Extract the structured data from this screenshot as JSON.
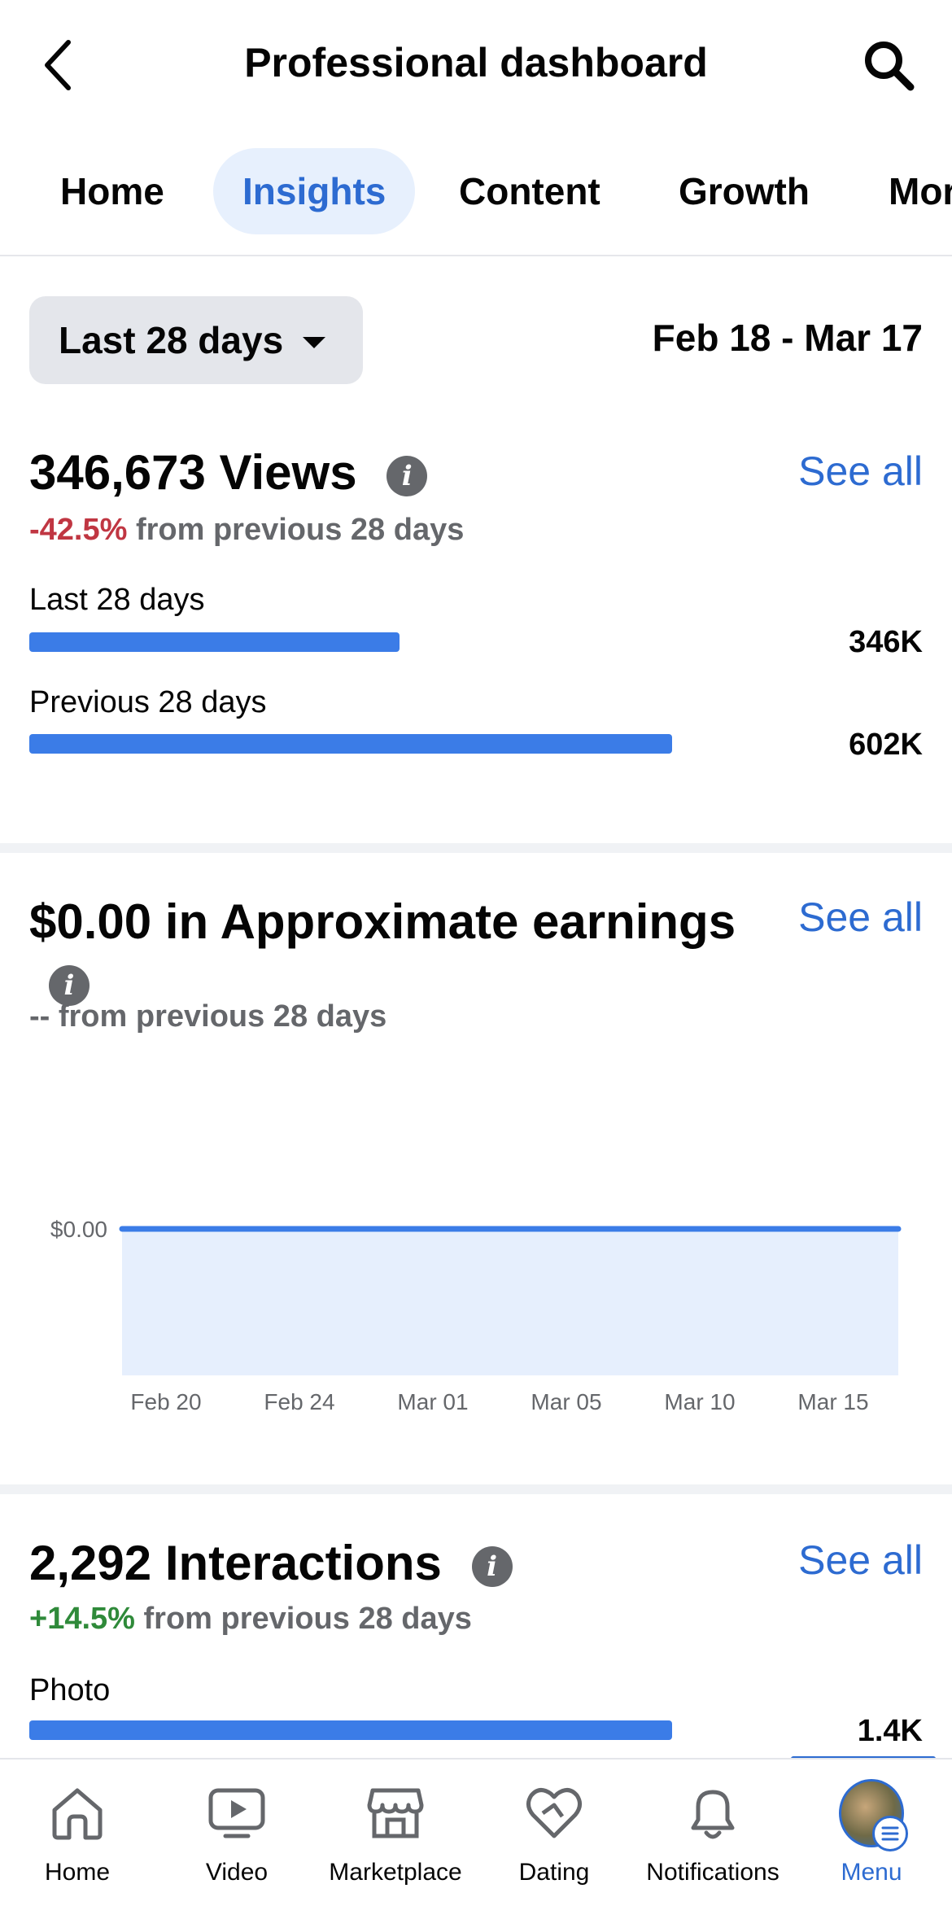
{
  "header": {
    "title": "Professional dashboard"
  },
  "tabs": [
    {
      "label": "Home"
    },
    {
      "label": "Insights"
    },
    {
      "label": "Content"
    },
    {
      "label": "Growth"
    },
    {
      "label": "More"
    }
  ],
  "filter": {
    "range_label": "Last 28 days",
    "date_range": "Feb 18 - Mar 17"
  },
  "views": {
    "title": "346,673 Views",
    "see_all": "See all",
    "change": "-42.5%",
    "change_suffix": " from previous 28 days",
    "bars": [
      {
        "label": "Last 28 days",
        "value": "346K",
        "fraction": 0.576
      },
      {
        "label": "Previous 28 days",
        "value": "602K",
        "fraction": 1.0
      }
    ]
  },
  "earnings": {
    "title": "$0.00 in Approximate earnings",
    "see_all": "See all",
    "change_line": "-- from previous 28 days"
  },
  "chart_data": {
    "type": "area",
    "title": "",
    "xlabel": "",
    "ylabel": "",
    "y_tick_labels": [
      "$0.00"
    ],
    "x_tick_labels": [
      "Feb 20",
      "Feb 24",
      "Mar 01",
      "Mar 05",
      "Mar 10",
      "Mar 15"
    ],
    "x": [
      "Feb 18",
      "Mar 17"
    ],
    "values": [
      0,
      0
    ],
    "grid": false
  },
  "interactions": {
    "title": "2,292 Interactions",
    "see_all": "See all",
    "change": "+14.5%",
    "change_suffix": " from previous 28 days",
    "bars": [
      {
        "label": "Photo",
        "value": "1.4K",
        "fraction": 1.0
      }
    ]
  },
  "colors": {
    "accent": "#2d6bd1",
    "bar": "#3b7ce7",
    "negative": "#c03642",
    "positive": "#2f8a3a"
  },
  "bottom_nav": [
    {
      "label": "Home",
      "icon": "home-icon"
    },
    {
      "label": "Video",
      "icon": "video-icon"
    },
    {
      "label": "Marketplace",
      "icon": "marketplace-icon"
    },
    {
      "label": "Dating",
      "icon": "dating-icon"
    },
    {
      "label": "Notifications",
      "icon": "bell-icon"
    },
    {
      "label": "Menu",
      "icon": "avatar"
    }
  ]
}
